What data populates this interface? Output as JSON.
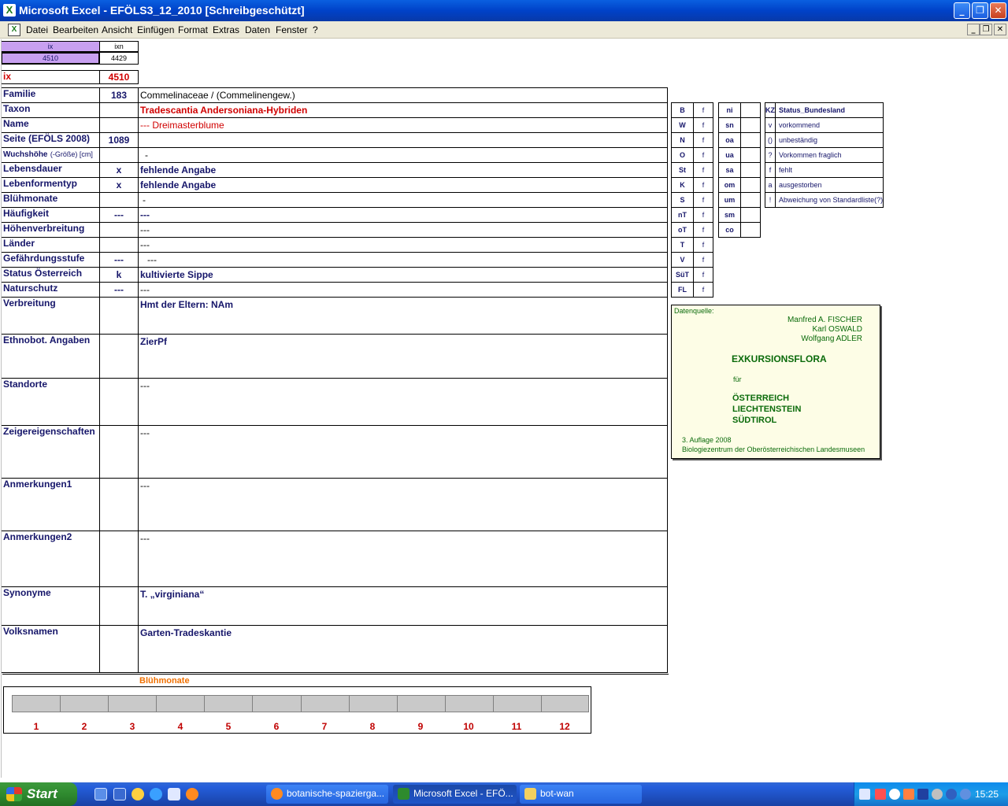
{
  "window": {
    "title": "Microsoft Excel - EFÖLS3_12_2010  [Schreibgeschützt]"
  },
  "menu": {
    "items": [
      "Datei",
      "Bearbeiten",
      "Ansicht",
      "Einfügen",
      "Format",
      "Extras",
      "Daten",
      "Fenster",
      "?"
    ]
  },
  "index_table": {
    "header_ix": "ix",
    "header_ixn": "ixn",
    "value_ix": "4510",
    "value_ixn": "4429"
  },
  "current_ix": {
    "label": "ix",
    "value": "4510"
  },
  "fields": [
    {
      "label": "Familie",
      "code": "183",
      "value": "Commelinaceae  /  (Commelinengew.)"
    },
    {
      "label": "Taxon",
      "code": "",
      "value": "Tradescantia Andersoniana-Hybriden"
    },
    {
      "label": "Name",
      "code": "",
      "value": "--- Dreimasterblume"
    },
    {
      "label": "Seite (EFÖLS 2008)",
      "code": "1089",
      "value": ""
    },
    {
      "label": "Wuchshöhe",
      "label_suffix": "(-Größe) [cm]",
      "code": "",
      "value": "-"
    },
    {
      "label": "Lebensdauer",
      "code": "x",
      "value": "fehlende Angabe"
    },
    {
      "label": "Lebenformentyp",
      "code": "x",
      "value": "fehlende Angabe"
    },
    {
      "label": "Blühmonate",
      "code": "",
      "value": "-"
    },
    {
      "label": "Häufigkeit",
      "code": "---",
      "value": "---"
    },
    {
      "label": "Höhenverbreitung",
      "code": "",
      "value": "---"
    },
    {
      "label": "Länder",
      "code": "",
      "value": "---"
    },
    {
      "label": "Gefährdungsstufe",
      "code": "---",
      "value": "---"
    },
    {
      "label": "Status Österreich",
      "code": "k",
      "value": "kultivierte Sippe"
    },
    {
      "label": "Naturschutz",
      "code": "---",
      "value": "---"
    },
    {
      "label": "Verbreitung",
      "code": "",
      "value": "Hmt der Eltern: NAm"
    },
    {
      "label": "Ethnobot. Angaben",
      "code": "",
      "value": "ZierPf"
    },
    {
      "label": "Standorte",
      "code": "",
      "value": "---"
    },
    {
      "label": "Zeigereigenschaften",
      "code": "",
      "value": "---"
    },
    {
      "label": "Anmerkungen1",
      "code": "",
      "value": "---"
    },
    {
      "label": "Anmerkungen2",
      "code": "",
      "value": "---"
    },
    {
      "label": "Synonyme",
      "code": "",
      "value": "T. „virginiana“"
    },
    {
      "label": "Volksnamen",
      "code": "",
      "value": "Garten-Tradeskantie"
    }
  ],
  "regions_table": [
    {
      "code": "B",
      "flag": "f"
    },
    {
      "code": "W",
      "flag": "f"
    },
    {
      "code": "N",
      "flag": "f"
    },
    {
      "code": "O",
      "flag": "f"
    },
    {
      "code": "St",
      "flag": "f"
    },
    {
      "code": "K",
      "flag": "f"
    },
    {
      "code": "S",
      "flag": "f"
    },
    {
      "code": "nT",
      "flag": "f"
    },
    {
      "code": "oT",
      "flag": "f"
    },
    {
      "code": "T",
      "flag": "f"
    },
    {
      "code": "V",
      "flag": "f"
    },
    {
      "code": "SüT",
      "flag": "f"
    },
    {
      "code": "FL",
      "flag": "f"
    }
  ],
  "altitude_table": [
    {
      "code": "ni",
      "value": ""
    },
    {
      "code": "sn",
      "value": ""
    },
    {
      "code": "oa",
      "value": ""
    },
    {
      "code": "ua",
      "value": ""
    },
    {
      "code": "sa",
      "value": ""
    },
    {
      "code": "om",
      "value": ""
    },
    {
      "code": "um",
      "value": ""
    },
    {
      "code": "sm",
      "value": ""
    },
    {
      "code": "co",
      "value": ""
    }
  ],
  "status_legend": {
    "header_code": "KZ",
    "header_label": "Status_Bundesland",
    "rows": [
      {
        "code": "v",
        "label": "vorkommend"
      },
      {
        "code": "()",
        "label": "unbeständig"
      },
      {
        "code": "?",
        "label": "Vorkommen fraglich"
      },
      {
        "code": "f",
        "label": "fehlt"
      },
      {
        "code": "a",
        "label": "ausgestorben"
      },
      {
        "code": "!",
        "label": "Abweichung von Standardliste(?)"
      }
    ]
  },
  "source": {
    "heading": "Datenquelle:",
    "author1": "Manfred A. FISCHER",
    "author2": "Karl OSWALD",
    "author3": "Wolfgang ADLER",
    "title": "EXKURSIONSFLORA",
    "fuer": "für",
    "country1": "ÖSTERREICH",
    "country2": "LIECHTENSTEIN",
    "country3": "SÜDTIROL",
    "edition": "3. Auflage 2008",
    "publisher": "Biologiezentrum der Oberösterreichischen Landesmuseen"
  },
  "chart_data": {
    "type": "bar",
    "title": "Blühmonate",
    "categories": [
      "1",
      "2",
      "3",
      "4",
      "5",
      "6",
      "7",
      "8",
      "9",
      "10",
      "11",
      "12"
    ],
    "values": [
      0,
      0,
      0,
      0,
      0,
      0,
      0,
      0,
      0,
      0,
      0,
      0
    ]
  },
  "taskbar": {
    "start_label": "Start",
    "items": [
      {
        "label": "botanische-spazierga...",
        "active": false
      },
      {
        "label": "Microsoft Excel - EFÖ...",
        "active": true
      },
      {
        "label": "bot-wan",
        "active": false
      }
    ],
    "clock": "15:25"
  },
  "colors": {
    "title_blue": "#0a5fe0",
    "label_navy": "#16166a",
    "taxon_red": "#d00000",
    "source_green": "#0b6b0b",
    "chart_title_orange": "#f07000",
    "ix_header_violet": "#c8a0f0"
  }
}
